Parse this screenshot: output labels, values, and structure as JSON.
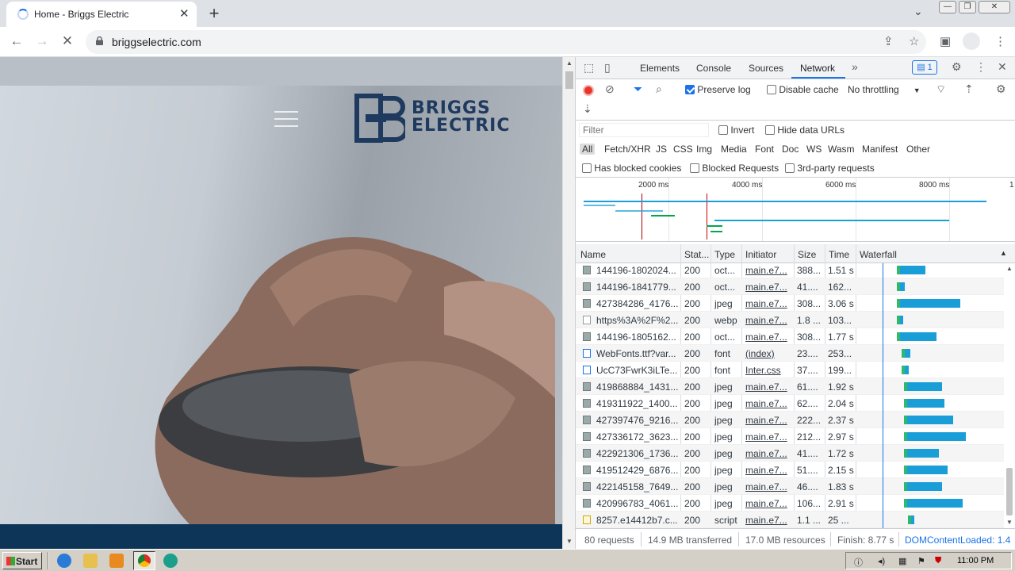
{
  "browser": {
    "tab_title": "Home - Briggs Electric",
    "url": "briggselectric.com"
  },
  "site": {
    "logo_line1": "BRIGGS",
    "logo_line2": "ELECTRIC"
  },
  "devtools": {
    "tabs": [
      "Elements",
      "Console",
      "Sources",
      "Network"
    ],
    "active_tab": "Network",
    "issues_count": "1",
    "preserve_log": "Preserve log",
    "disable_cache": "Disable cache",
    "throttling": "No throttling",
    "filter_placeholder": "Filter",
    "invert": "Invert",
    "hide_data_urls": "Hide data URLs",
    "type_filters": [
      "All",
      "Fetch/XHR",
      "JS",
      "CSS",
      "Img",
      "Media",
      "Font",
      "Doc",
      "WS",
      "Wasm",
      "Manifest",
      "Other"
    ],
    "blocked_cookies": "Has blocked cookies",
    "blocked_requests": "Blocked Requests",
    "third_party": "3rd-party requests",
    "timeline_ticks": [
      "2000 ms",
      "4000 ms",
      "6000 ms",
      "8000 ms",
      "1"
    ],
    "columns": [
      "Name",
      "Stat...",
      "Type",
      "Initiator",
      "Size",
      "Time",
      "Waterfall"
    ],
    "rows": [
      {
        "name": "144196-1802024...",
        "status": "200",
        "type": "oct...",
        "initiator": "main.e7...",
        "size": "388...",
        "time": "1.51 s",
        "icon": "img",
        "wf_start": 0.27,
        "wf_len": 0.18
      },
      {
        "name": "144196-1841779...",
        "status": "200",
        "type": "oct...",
        "initiator": "main.e7...",
        "size": "41....",
        "time": "162...",
        "icon": "img",
        "wf_start": 0.27,
        "wf_len": 0.03
      },
      {
        "name": "427384286_4176...",
        "status": "200",
        "type": "jpeg",
        "initiator": "main.e7...",
        "size": "308...",
        "time": "3.06 s",
        "icon": "img",
        "wf_start": 0.27,
        "wf_len": 0.43
      },
      {
        "name": "https%3A%2F%2...",
        "status": "200",
        "type": "webp",
        "initiator": "main.e7...",
        "size": "1.8 ...",
        "time": "103...",
        "icon": "webp",
        "wf_start": 0.27,
        "wf_len": 0.02
      },
      {
        "name": "144196-1805162...",
        "status": "200",
        "type": "oct...",
        "initiator": "main.e7...",
        "size": "308...",
        "time": "1.77 s",
        "icon": "img",
        "wf_start": 0.27,
        "wf_len": 0.26
      },
      {
        "name": "WebFonts.ttf?var...",
        "status": "200",
        "type": "font",
        "initiator": "(index)",
        "size": "23....",
        "time": "253...",
        "icon": "font",
        "wf_start": 0.3,
        "wf_len": 0.04
      },
      {
        "name": "UcC73FwrK3iLTe...",
        "status": "200",
        "type": "font",
        "initiator": "Inter.css",
        "size": "37....",
        "time": "199...",
        "icon": "font",
        "wf_start": 0.3,
        "wf_len": 0.03
      },
      {
        "name": "419868884_1431...",
        "status": "200",
        "type": "jpeg",
        "initiator": "main.e7...",
        "size": "61....",
        "time": "1.92 s",
        "icon": "img",
        "wf_start": 0.32,
        "wf_len": 0.25
      },
      {
        "name": "419311922_1400...",
        "status": "200",
        "type": "jpeg",
        "initiator": "main.e7...",
        "size": "62....",
        "time": "2.04 s",
        "icon": "img",
        "wf_start": 0.32,
        "wf_len": 0.27
      },
      {
        "name": "427397476_9216...",
        "status": "200",
        "type": "jpeg",
        "initiator": "main.e7...",
        "size": "222...",
        "time": "2.37 s",
        "icon": "img",
        "wf_start": 0.32,
        "wf_len": 0.33
      },
      {
        "name": "427336172_3623...",
        "status": "200",
        "type": "jpeg",
        "initiator": "main.e7...",
        "size": "212...",
        "time": "2.97 s",
        "icon": "img",
        "wf_start": 0.32,
        "wf_len": 0.42
      },
      {
        "name": "422921306_1736...",
        "status": "200",
        "type": "jpeg",
        "initiator": "main.e7...",
        "size": "41....",
        "time": "1.72 s",
        "icon": "img",
        "wf_start": 0.32,
        "wf_len": 0.23
      },
      {
        "name": "419512429_6876...",
        "status": "200",
        "type": "jpeg",
        "initiator": "main.e7...",
        "size": "51....",
        "time": "2.15 s",
        "icon": "img",
        "wf_start": 0.32,
        "wf_len": 0.29
      },
      {
        "name": "422145158_7649...",
        "status": "200",
        "type": "jpeg",
        "initiator": "main.e7...",
        "size": "46....",
        "time": "1.83 s",
        "icon": "img",
        "wf_start": 0.32,
        "wf_len": 0.25
      },
      {
        "name": "420996783_4061...",
        "status": "200",
        "type": "jpeg",
        "initiator": "main.e7...",
        "size": "106...",
        "time": "2.91 s",
        "icon": "img",
        "wf_start": 0.32,
        "wf_len": 0.4
      },
      {
        "name": "8257.e14412b7.c...",
        "status": "200",
        "type": "script",
        "initiator": "main.e7...",
        "size": "1.1 ...",
        "time": "25 ...",
        "icon": "script",
        "wf_start": 0.35,
        "wf_len": 0.02
      }
    ],
    "status_bar": {
      "requests": "80 requests",
      "transferred": "14.9 MB transferred",
      "resources": "17.0 MB resources",
      "finish": "Finish: 8.77 s",
      "dom_loaded": "DOMContentLoaded: 1.4"
    }
  },
  "taskbar": {
    "start": "Start",
    "clock": "11:00 PM"
  },
  "colors": {
    "accent": "#1a73e8",
    "record": "#e8352c",
    "footer_band": "#0d3558",
    "logo": "#1e3a5f",
    "waterfall_bar": "#1a9ed8"
  }
}
